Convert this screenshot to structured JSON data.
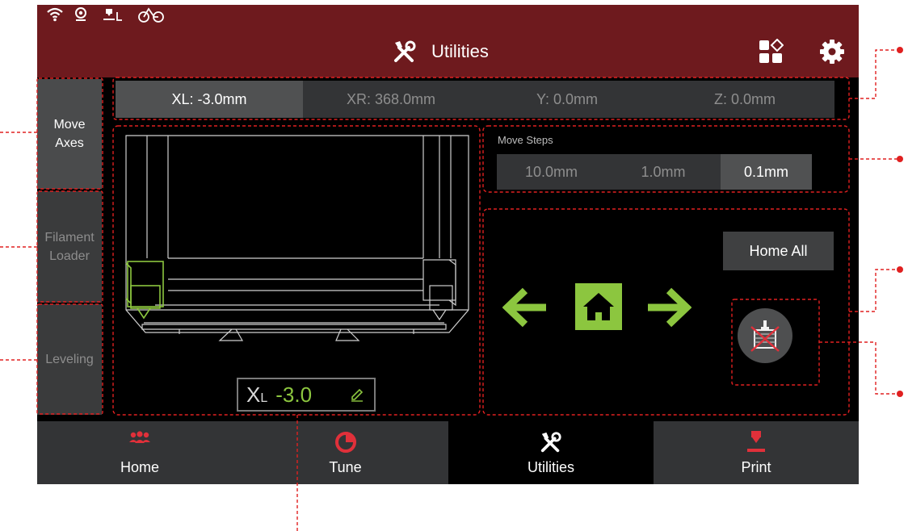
{
  "header": {
    "title": "Utilities"
  },
  "status_icons": [
    "wifi-icon",
    "webcam-icon",
    "extruder-left-icon",
    "bike-infinity-icon"
  ],
  "header_icons": [
    "utilities-tools-icon",
    "widgets-icon",
    "settings-gear-icon"
  ],
  "side_tabs": [
    {
      "label_line1": "Move",
      "label_line2": "Axes",
      "active": true
    },
    {
      "label_line1": "Filament",
      "label_line2": "Loader",
      "active": false
    },
    {
      "label_line1": "Leveling",
      "label_line2": "",
      "active": false
    }
  ],
  "positions": [
    {
      "label": "XL: -3.0mm",
      "active": true
    },
    {
      "label": "XR: 368.0mm",
      "active": false
    },
    {
      "label": "Y: 0.0mm",
      "active": false
    },
    {
      "label": "Z: 0.0mm",
      "active": false
    }
  ],
  "move_steps": {
    "label": "Move Steps",
    "options": [
      {
        "label": "10.0mm",
        "active": false
      },
      {
        "label": "1.0mm",
        "active": false
      },
      {
        "label": "0.1mm",
        "active": true
      }
    ]
  },
  "axis_input": {
    "axis": "X",
    "axis_sub": "L",
    "value": "-3.0"
  },
  "controls": {
    "home_all": "Home All"
  },
  "bottom_nav": [
    {
      "label": "Home",
      "icon": "home-group-icon",
      "active": false
    },
    {
      "label": "Tune",
      "icon": "tune-pie-icon",
      "active": false
    },
    {
      "label": "Utilities",
      "icon": "utilities-tools-icon",
      "active": true
    },
    {
      "label": "Print",
      "icon": "print-nozzle-icon",
      "active": false
    }
  ],
  "colors": {
    "header_bg": "#6e1a1e",
    "accent_green": "#8cc63f",
    "accent_red": "#e0303a",
    "annotation_red": "#e02020"
  }
}
